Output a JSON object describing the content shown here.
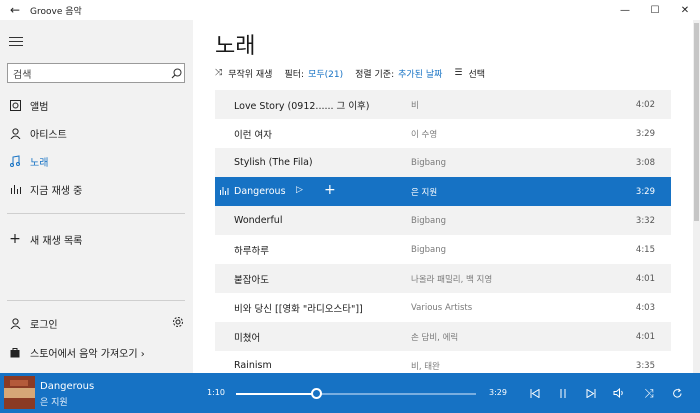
{
  "app": {
    "title": "Groove 음악"
  },
  "sidebar": {
    "search_placeholder": "검색",
    "nav": [
      {
        "label": "앨범",
        "icon": "album-icon"
      },
      {
        "label": "아티스트",
        "icon": "person-icon"
      },
      {
        "label": "노래",
        "icon": "music-note-icon",
        "active": true
      },
      {
        "label": "지금 재생 중",
        "icon": "now-playing-bars-icon"
      }
    ],
    "new_playlist": "새 재생 목록",
    "signin": "로그인",
    "store": "스토어에서 음악 가져오기 ›"
  },
  "main": {
    "title": "노래",
    "toolbar": {
      "shuffle": "무작위 재생",
      "filter_label": "필터:",
      "filter_value": "모두(21)",
      "sort_label": "정렬 기준:",
      "sort_value": "추가된 날짜",
      "select": "선택"
    },
    "songs": [
      {
        "title": "Love Story (0912...... 그 이후)",
        "artist": "비",
        "duration": "4:02"
      },
      {
        "title": "이런 여자",
        "artist": "이 수영",
        "duration": "3:29"
      },
      {
        "title": "Stylish (The Fila)",
        "artist": "Bigbang",
        "duration": "3:08"
      },
      {
        "title": "Dangerous",
        "artist": "은 지원",
        "duration": "3:29",
        "selected": true
      },
      {
        "title": "Wonderful",
        "artist": "Bigbang",
        "duration": "3:32"
      },
      {
        "title": "하루하루",
        "artist": "Bigbang",
        "duration": "4:15"
      },
      {
        "title": "붙잡아도",
        "artist": "나올라 패밀리, 백 지영",
        "duration": "4:01"
      },
      {
        "title": "비와 당신 [[영화 \"라디오스타\"]]",
        "artist": "Various Artists",
        "duration": "4:03"
      },
      {
        "title": "미쳤어",
        "artist": "손 담비, 에릭",
        "duration": "4:01"
      },
      {
        "title": "Rainism",
        "artist": "비, 태완",
        "duration": "3:35"
      }
    ]
  },
  "player": {
    "title": "Dangerous",
    "artist": "은 지원",
    "current_time": "1:10",
    "total_time": "3:29",
    "progress_fraction": 0.335
  },
  "colors": {
    "accent": "#1672c4",
    "sidebar_bg": "#f2f2f2",
    "row_alt": "#f2f2f2"
  }
}
